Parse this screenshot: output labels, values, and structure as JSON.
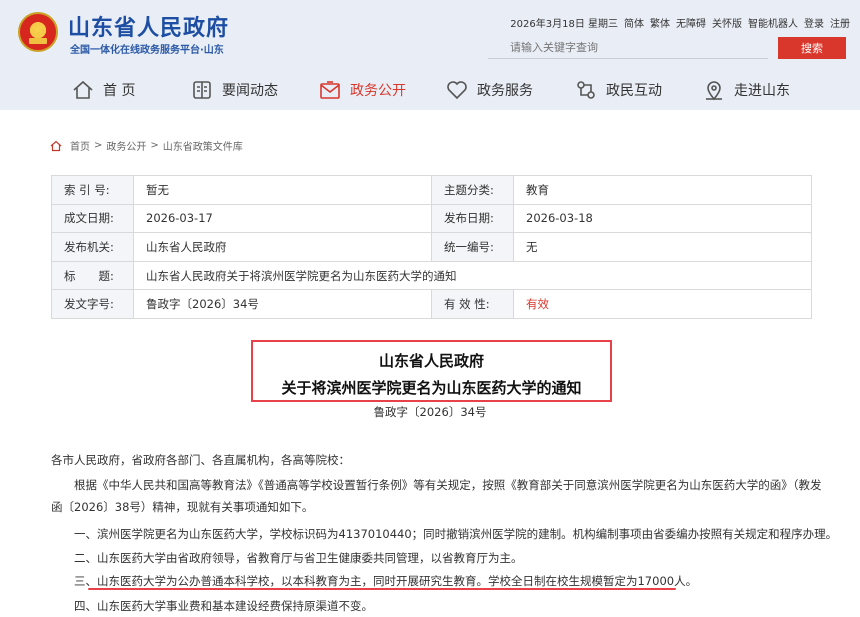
{
  "header": {
    "site_title": "山东省人民政府",
    "site_subtitle": "全国一体化在线政务服务平台·山东",
    "date": "2026年3月18日 星期三",
    "links": [
      "简体",
      "繁体",
      "无障碍",
      "关怀版",
      "智能机器人",
      "登录",
      "注册"
    ],
    "search_placeholder": "请输入关键字查询",
    "search_button": "搜索"
  },
  "nav": [
    {
      "label": "首 页",
      "icon": "home-icon"
    },
    {
      "label": "要闻动态",
      "icon": "book-icon"
    },
    {
      "label": "政务公开",
      "icon": "mail-icon",
      "active": true
    },
    {
      "label": "政务服务",
      "icon": "heart-icon"
    },
    {
      "label": "政民互动",
      "icon": "interaction-icon"
    },
    {
      "label": "走进山东",
      "icon": "location-icon"
    }
  ],
  "breadcrumb": [
    "首页",
    "政务公开",
    "山东省政策文件库"
  ],
  "meta": {
    "index_label": "索 引 号:",
    "index_value": "暂无",
    "topic_label": "主题分类:",
    "topic_value": "教育",
    "created_label": "成文日期:",
    "created_value": "2026-03-17",
    "published_label": "发布日期:",
    "published_value": "2026-03-18",
    "issuer_label": "发布机关:",
    "issuer_value": "山东省人民政府",
    "code_label": "统一编号:",
    "code_value": "无",
    "title_label": "标　　题:",
    "title_value": "山东省人民政府关于将滨州医学院更名为山东医药大学的通知",
    "docno_label": "发文字号:",
    "docno_value": "鲁政字〔2026〕34号",
    "validity_label": "有 效 性:",
    "validity_value": "有效"
  },
  "doc": {
    "title_line1": "山东省人民政府",
    "title_line2": "关于将滨州医学院更名为山东医药大学的通知",
    "number": "鲁政字〔2026〕34号",
    "paragraphs": [
      "各市人民政府，省政府各部门、各直属机构，各高等院校：",
      "根据《中华人民共和国高等教育法》《普通高等学校设置暂行条例》等有关规定，按照《教育部关于同意滨州医学院更名为山东医药大学的函》（教发",
      "函〔2026〕38号）精神，现就有关事项通知如下。",
      "一、滨州医学院更名为山东医药大学，学校标识码为4137010440；同时撤销滨州医学院的建制。机构编制事项由省委编办按照有关规定和程序办理。",
      "二、山东医药大学由省政府领导，省教育厅与省卫生健康委共同管理，以省教育厅为主。",
      "三、山东医药大学为公办普通本科学校，以本科教育为主，同时开展研究生教育。学校全日制在校生规模暂定为17000人。",
      "四、山东医药大学事业费和基本建设经费保持原渠道不变。"
    ]
  },
  "colors": {
    "accent": "#d9372b",
    "brand_blue": "#1d4ea3",
    "highlight": "#e8414a"
  }
}
